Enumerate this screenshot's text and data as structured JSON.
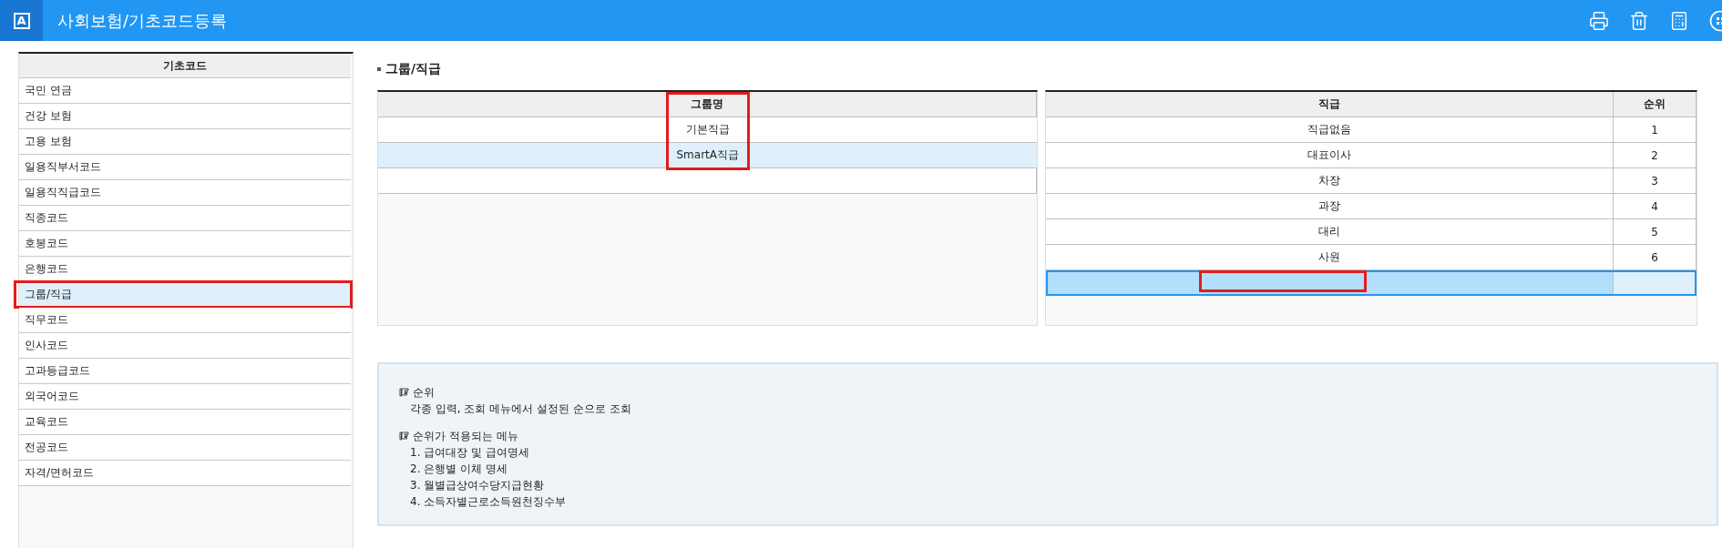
{
  "app": {
    "logo": "A",
    "title": "사회보험/기초코드등록"
  },
  "sidebar": {
    "header": "기초코드",
    "items": [
      {
        "label": "국민 연금",
        "selected": false,
        "highlighted": false
      },
      {
        "label": "건강 보험",
        "selected": false,
        "highlighted": false
      },
      {
        "label": "고용 보험",
        "selected": false,
        "highlighted": false
      },
      {
        "label": "일용직부서코드",
        "selected": false,
        "highlighted": false
      },
      {
        "label": "일용직직급코드",
        "selected": false,
        "highlighted": false
      },
      {
        "label": "직종코드",
        "selected": false,
        "highlighted": false
      },
      {
        "label": "호봉코드",
        "selected": false,
        "highlighted": false
      },
      {
        "label": "은행코드",
        "selected": false,
        "highlighted": false
      },
      {
        "label": "그룹/직급",
        "selected": true,
        "highlighted": true
      },
      {
        "label": "직무코드",
        "selected": false,
        "highlighted": false
      },
      {
        "label": "인사코드",
        "selected": false,
        "highlighted": false
      },
      {
        "label": "고과등급코드",
        "selected": false,
        "highlighted": false
      },
      {
        "label": "외국어코드",
        "selected": false,
        "highlighted": false
      },
      {
        "label": "교육코드",
        "selected": false,
        "highlighted": false
      },
      {
        "label": "전공코드",
        "selected": false,
        "highlighted": false
      },
      {
        "label": "자격/면허코드",
        "selected": false,
        "highlighted": false
      }
    ]
  },
  "section_title": "그룹/직급",
  "group_table": {
    "column": "그룹명",
    "highlighted": true,
    "rows": [
      {
        "name": "기본직급",
        "selected": false
      },
      {
        "name": "SmartA직급",
        "selected": true
      }
    ]
  },
  "rank_table": {
    "columns": [
      "직급",
      "순위"
    ],
    "rows": [
      {
        "rank": "직급없음",
        "order": "1"
      },
      {
        "rank": "대표이사",
        "order": "2"
      },
      {
        "rank": "차장",
        "order": "3"
      },
      {
        "rank": "과장",
        "order": "4"
      },
      {
        "rank": "대리",
        "order": "5"
      },
      {
        "rank": "사원",
        "order": "6"
      }
    ],
    "new_row": {
      "selected": true,
      "highlighted": true
    }
  },
  "notes": [
    {
      "heading": "순위",
      "lines": [
        "각종 입력, 조회 메뉴에서 설정된 순으로 조회"
      ]
    },
    {
      "heading": "순위가 적용되는 메뉴",
      "lines": [
        "1. 급여대장 및 급여명세",
        "2. 은행별 이체 명세",
        "3. 월별급상여수당지급현황",
        "4. 소득자별근로소득원천징수부"
      ]
    }
  ]
}
